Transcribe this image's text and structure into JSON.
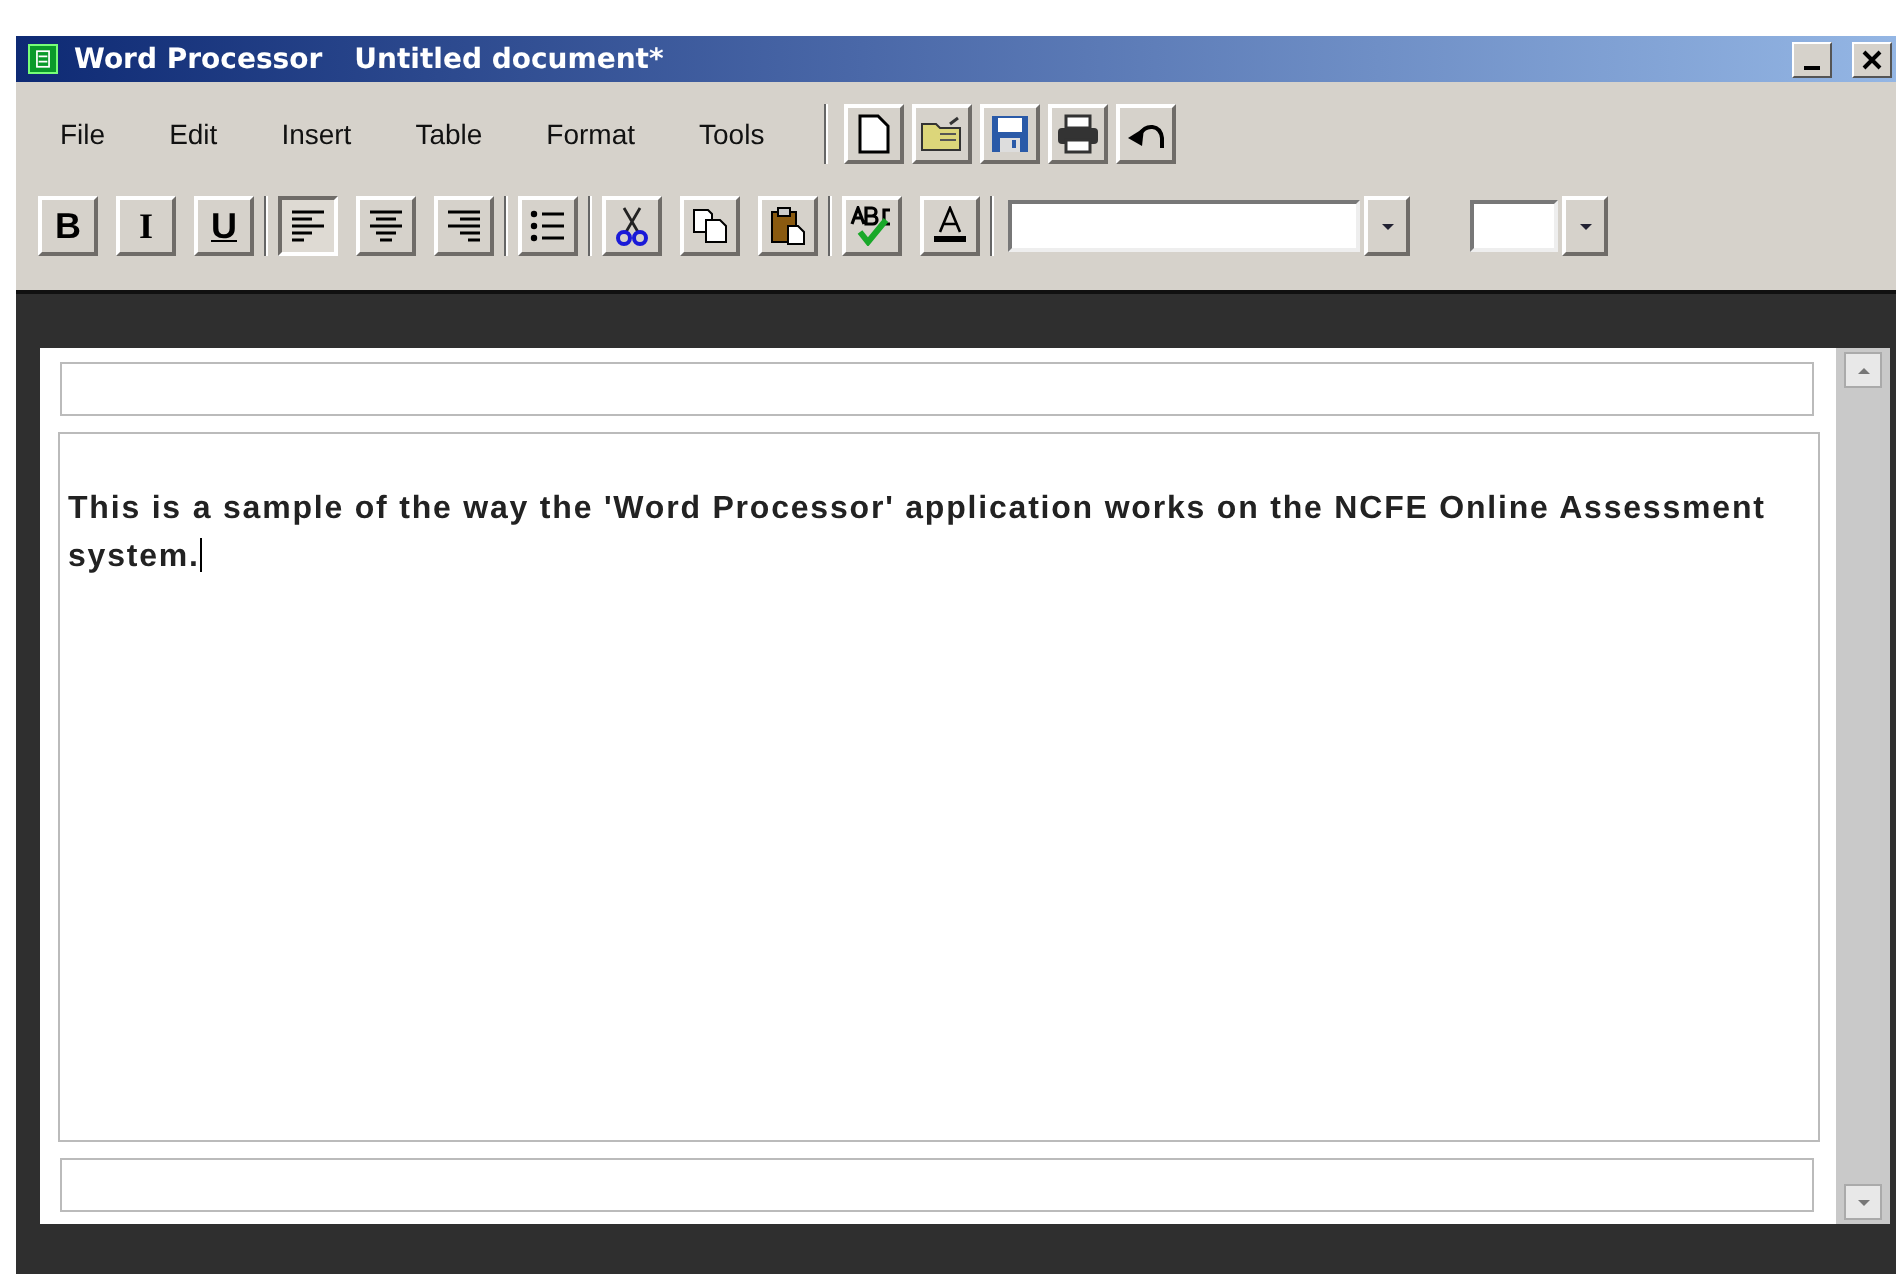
{
  "window": {
    "title": "Word Processor",
    "document_name": "Untitled document*"
  },
  "menu": [
    "File",
    "Edit",
    "Insert",
    "Table",
    "Format",
    "Tools"
  ],
  "file_tools": [
    {
      "kind": "new"
    },
    {
      "kind": "open"
    },
    {
      "kind": "save"
    },
    {
      "kind": "print"
    },
    {
      "kind": "undo"
    }
  ],
  "format_tools": [
    [
      {
        "kind": "bold",
        "label": "B"
      },
      {
        "kind": "italic",
        "label": "I"
      },
      {
        "kind": "underline",
        "label": "U"
      }
    ],
    [
      {
        "kind": "align-left",
        "selected": true
      },
      {
        "kind": "align-center",
        "selected": false
      },
      {
        "kind": "align-right",
        "selected": false
      }
    ],
    [
      {
        "kind": "bullets"
      }
    ],
    [
      {
        "kind": "cut"
      },
      {
        "kind": "copy"
      },
      {
        "kind": "paste"
      }
    ],
    [
      {
        "kind": "spell"
      },
      {
        "kind": "font-color"
      }
    ]
  ],
  "document": {
    "text": "This is a sample of the way the 'Word Processor' application works on the NCFE Online Assessment system.",
    "caret": true
  }
}
